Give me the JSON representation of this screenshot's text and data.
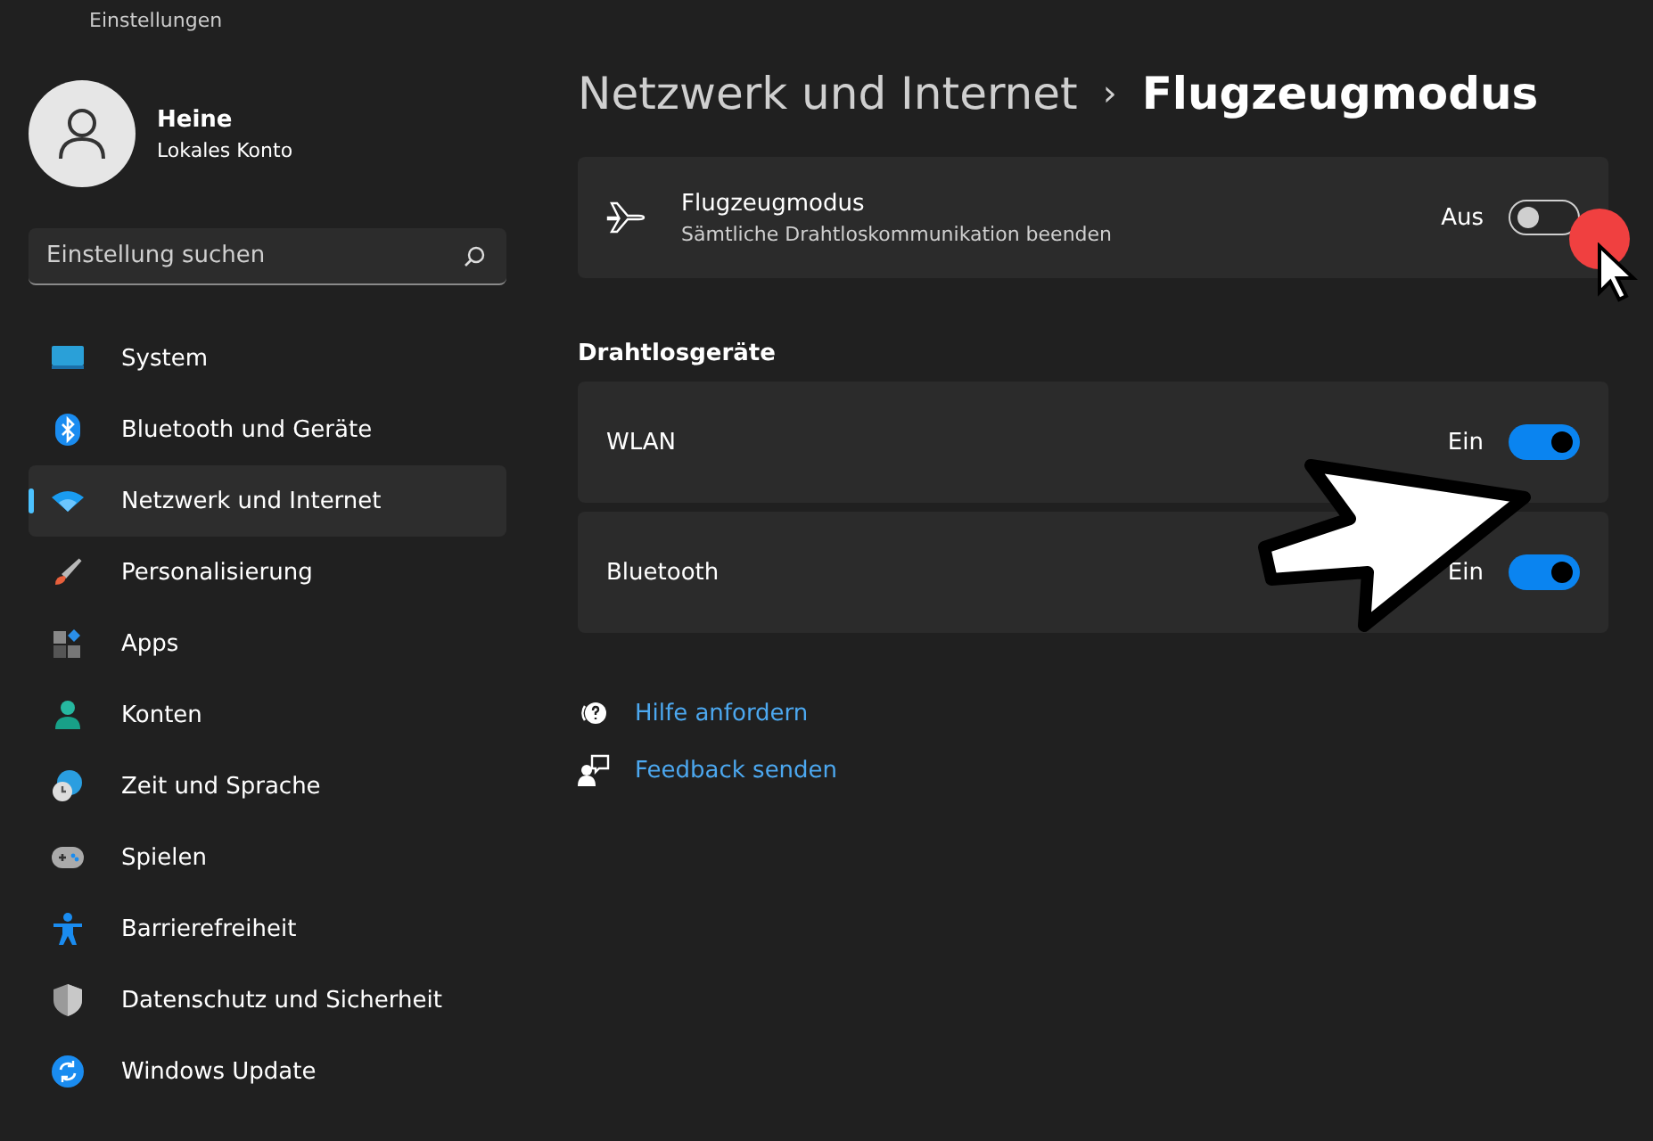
{
  "window": {
    "title": "Einstellungen"
  },
  "account": {
    "name": "Heine",
    "type": "Lokales Konto"
  },
  "search": {
    "placeholder": "Einstellung suchen"
  },
  "sidebar": {
    "items": [
      {
        "label": "System",
        "selected": false
      },
      {
        "label": "Bluetooth und Geräte",
        "selected": false
      },
      {
        "label": "Netzwerk und Internet",
        "selected": true
      },
      {
        "label": "Personalisierung",
        "selected": false
      },
      {
        "label": "Apps",
        "selected": false
      },
      {
        "label": "Konten",
        "selected": false
      },
      {
        "label": "Zeit und Sprache",
        "selected": false
      },
      {
        "label": "Spielen",
        "selected": false
      },
      {
        "label": "Barrierefreiheit",
        "selected": false
      },
      {
        "label": "Datenschutz und Sicherheit",
        "selected": false
      },
      {
        "label": "Windows Update",
        "selected": false
      }
    ]
  },
  "breadcrumb": {
    "parent": "Netzwerk und Internet",
    "separator": "›",
    "current": "Flugzeugmodus"
  },
  "airplane_mode": {
    "title": "Flugzeugmodus",
    "description": "Sämtliche Drahtloskommunikation beenden",
    "state_label": "Aus",
    "on": false
  },
  "wireless_devices": {
    "heading": "Drahtlosgeräte",
    "items": [
      {
        "label": "WLAN",
        "state_label": "Ein",
        "on": true
      },
      {
        "label": "Bluetooth",
        "state_label": "Ein",
        "on": true
      }
    ]
  },
  "links": [
    {
      "label": "Hilfe anfordern"
    },
    {
      "label": "Feedback senden"
    }
  ]
}
